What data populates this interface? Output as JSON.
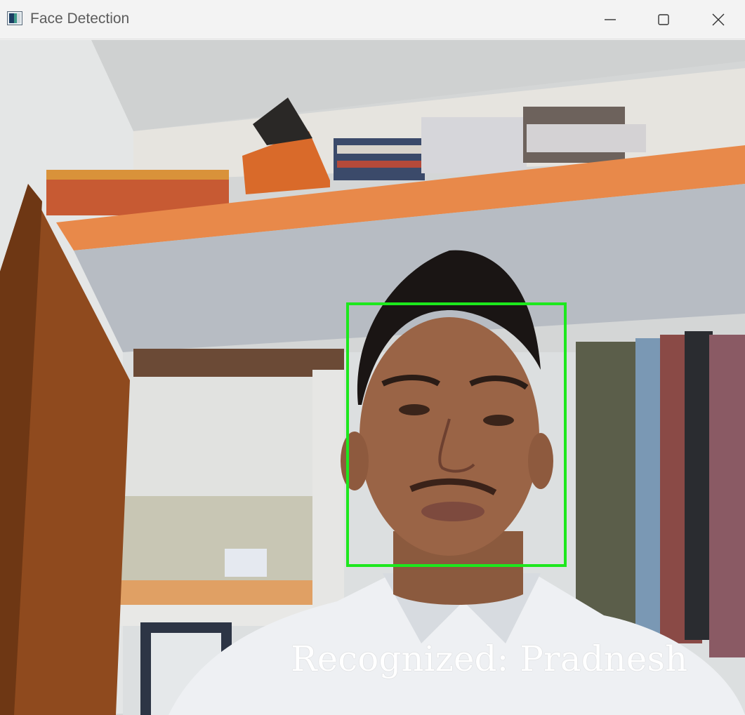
{
  "window": {
    "title": "Face Detection",
    "icons": {
      "app": "app-window-icon",
      "minimize": "minimize-icon",
      "maximize": "maximize-icon",
      "close": "close-icon"
    }
  },
  "video": {
    "detection": {
      "label": "Recognized: Pradnesh",
      "box_color": "#1de81d",
      "label_color": "#ffffff"
    }
  }
}
